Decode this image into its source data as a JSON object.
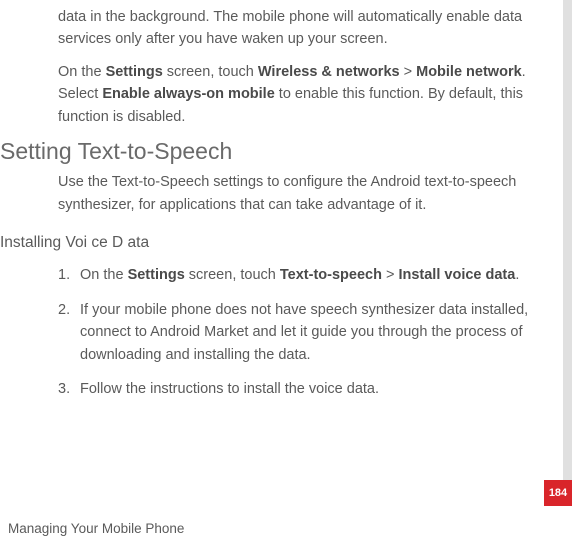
{
  "intro": {
    "p1": "data in the background. The mobile phone will automatically enable data services only after you have waken up your screen.",
    "p2_prefix": "On the ",
    "p2_b1": "Settings",
    "p2_mid1": " screen, touch ",
    "p2_b2": "Wireless & networks",
    "p2_gt": " > ",
    "p2_b3": "Mobile network",
    "p2_mid2": ". Select ",
    "p2_b4": "Enable always-on mobile",
    "p2_suffix": " to enable this function. By default, this function is disabled."
  },
  "h2": "Setting Text-to-Speech",
  "tts_desc": "Use the Text-to-Speech settings to configure the Android text-to-speech synthesizer, for applications that can take advantage of it.",
  "h3": "Installing Voi ce D ata",
  "steps": {
    "s1_prefix": "On the ",
    "s1_b1": "Settings",
    "s1_mid1": " screen, touch ",
    "s1_b2": "Text-to-speech",
    "s1_gt": " > ",
    "s1_b3": "Install voice data",
    "s1_suffix": ".",
    "s2": "If your mobile phone does not have speech synthesizer data installed, connect to Android Market and let it guide you through the process of downloading and installing the data.",
    "s3": "Follow the instructions to install the voice data."
  },
  "page_number": "184",
  "footer": "Managing Your Mobile Phone"
}
